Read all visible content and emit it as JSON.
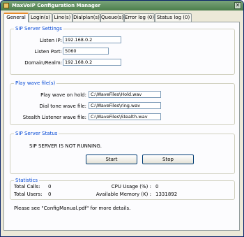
{
  "window": {
    "title": "MaxVoIP Configuration Manager",
    "close_glyph": "✕"
  },
  "tabs": [
    {
      "label": "General"
    },
    {
      "label": "Login(s)"
    },
    {
      "label": "Line(s)"
    },
    {
      "label": "Dialplan(s)"
    },
    {
      "label": "Queue(s)"
    },
    {
      "label": "Error log (0)"
    },
    {
      "label": "Status log (0)"
    }
  ],
  "sip_settings": {
    "title": "SIP Server Settings",
    "listen_ip_label": "Listen IP:",
    "listen_ip_value": "192.168.0.2",
    "listen_port_label": "Listen Port:",
    "listen_port_value": "5060",
    "domain_label": "Domain/Realm:",
    "domain_value": "192.168.0.2"
  },
  "wave": {
    "title": "Play wave file(s)",
    "on_hold_label": "Play wave on hold:",
    "on_hold_value": "C:\\WaveFiles\\Hold.wav",
    "dial_tone_label": "Dial tone wave file:",
    "dial_tone_value": "C:\\WaveFiles\\ring.wav",
    "stealth_label": "Stealth Listener wave file:",
    "stealth_value": "C:\\WaveFiles\\Stealth.wav"
  },
  "status": {
    "title": "SIP Server Status",
    "message": "SIP SERVER IS NOT RUNNING.",
    "start_label": "Start",
    "stop_label": "Stop"
  },
  "stats": {
    "title": "Statistics",
    "total_calls_label": "Total Calls:",
    "total_calls_value": "0",
    "total_users_label": "Total Users:",
    "total_users_value": "0",
    "cpu_label": "CPU Usage (%) :",
    "cpu_value": "0",
    "mem_label": "Available Memory (K) :",
    "mem_value": "1331892"
  },
  "footer": {
    "note": "Please see \"ConfigManual.pdf\" for more details."
  },
  "colors": {
    "titlebar": "#5a8a5a",
    "group_title": "#0046d5",
    "active_tab_accent": "#e68b2c"
  }
}
